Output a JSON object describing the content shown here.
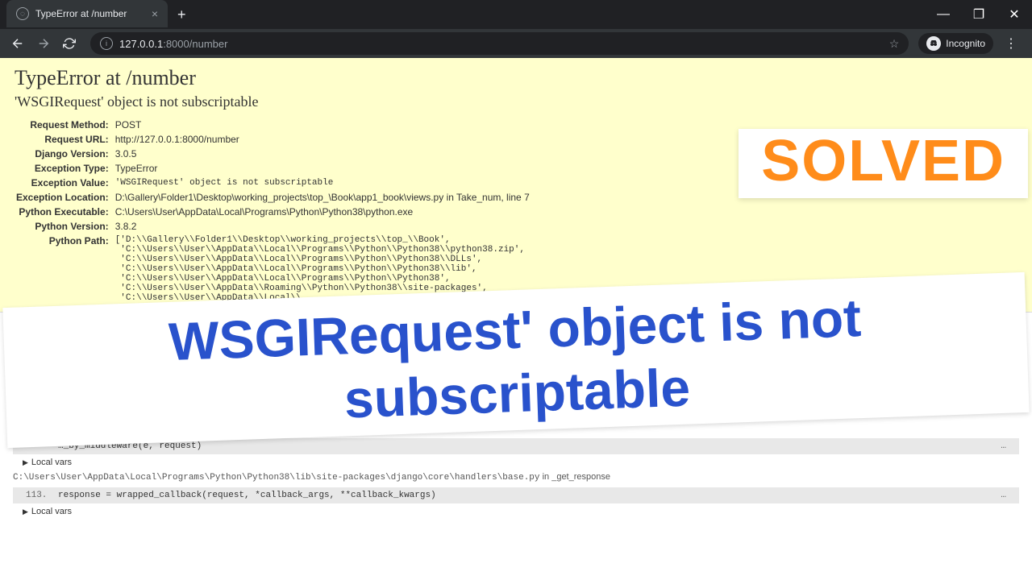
{
  "browser": {
    "tab_title": "TypeError at /number",
    "url_host": "127.0.0.1",
    "url_port_path": ":8000/number",
    "incognito_label": "Incognito"
  },
  "error": {
    "heading": "TypeError at /number",
    "exception_msg": "'WSGIRequest' object is not subscriptable",
    "rows": {
      "request_method": {
        "label": "Request Method:",
        "value": "POST"
      },
      "request_url": {
        "label": "Request URL:",
        "value": "http://127.0.0.1:8000/number"
      },
      "django_version": {
        "label": "Django Version:",
        "value": "3.0.5"
      },
      "exception_type": {
        "label": "Exception Type:",
        "value": "TypeError"
      },
      "exception_value": {
        "label": "Exception Value:",
        "value": "'WSGIRequest' object is not subscriptable"
      },
      "exception_location": {
        "label": "Exception Location:",
        "value": "D:\\Gallery\\Folder1\\Desktop\\working_projects\\top_\\Book\\app1_book\\views.py in Take_num, line 7"
      },
      "python_executable": {
        "label": "Python Executable:",
        "value": "C:\\Users\\User\\AppData\\Local\\Programs\\Python\\Python38\\python.exe"
      },
      "python_version": {
        "label": "Python Version:",
        "value": "3.8.2"
      },
      "python_path": {
        "label": "Python Path:",
        "value": "['D:\\\\Gallery\\\\Folder1\\\\Desktop\\\\working_projects\\\\top_\\\\Book',\n 'C:\\\\Users\\\\User\\\\AppData\\\\Local\\\\Programs\\\\Python\\\\Python38\\\\python38.zip',\n 'C:\\\\Users\\\\User\\\\AppData\\\\Local\\\\Programs\\\\Python\\\\Python38\\\\DLLs',\n 'C:\\\\Users\\\\User\\\\AppData\\\\Local\\\\Programs\\\\Python\\\\Python38\\\\lib',\n 'C:\\\\Users\\\\User\\\\AppData\\\\Local\\\\Programs\\\\Python\\\\Python38',\n 'C:\\\\Users\\\\User\\\\AppData\\\\Roaming\\\\Python\\\\Python38\\\\site-packages',\n 'C:\\\\Users\\\\User\\\\AppData\\\\Local\\\\ ..."
      }
    }
  },
  "traceback": {
    "frame1": {
      "code_fragment": "…_by_middleware(e, request)",
      "dots": "…"
    },
    "local_vars_label": "Local vars",
    "frame2": {
      "file": "C:\\Users\\User\\AppData\\Local\\Programs\\Python\\Python38\\lib\\site-packages\\django\\core\\handlers\\base.py",
      "in_word": " in ",
      "func": "_get_response",
      "lineno": "113.",
      "code": "response = wrapped_callback(request, *callback_args, **callback_kwargs)",
      "dots": "…"
    },
    "local_vars_label2": "Local vars"
  },
  "overlays": {
    "solved": "SOLVED",
    "message": "WSGIRequest' object is not subscriptable"
  }
}
